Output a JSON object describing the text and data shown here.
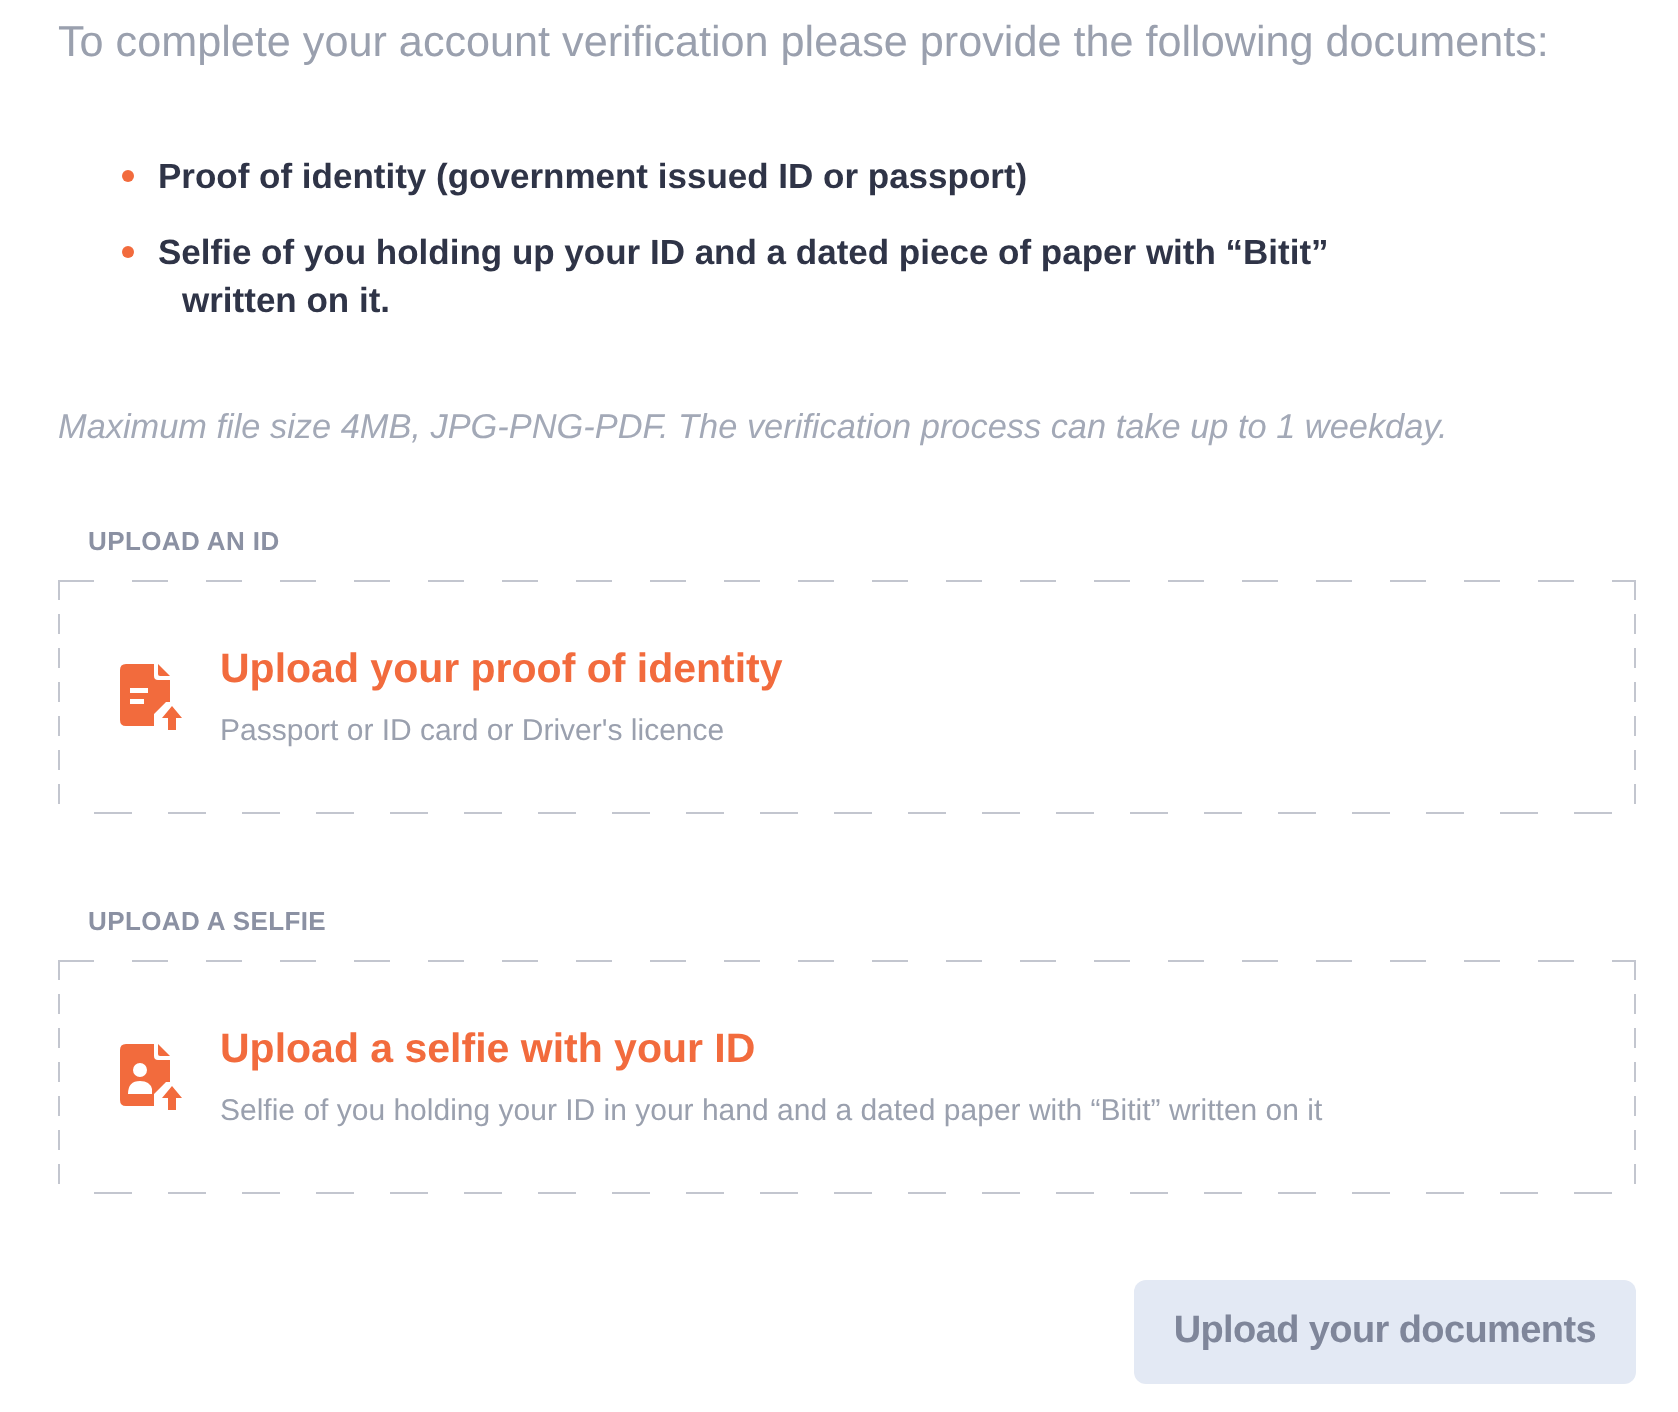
{
  "intro": "To complete your account verification please provide the following documents:",
  "requirements": [
    "Proof of identity (government issued ID or passport)",
    "Selfie of you holding up your ID and a dated piece of paper with “Bitit” written on it."
  ],
  "note": "Maximum file size 4MB, JPG-PNG-PDF. The verification process can take up to 1 weekday.",
  "uploads": [
    {
      "kind": "document",
      "label": "UPLOAD AN ID",
      "title": "Upload your proof of identity",
      "hint": "Passport or ID card or Driver's licence"
    },
    {
      "kind": "selfie",
      "label": "UPLOAD A SELFIE",
      "title": "Upload a selfie with your ID",
      "hint": "Selfie of you holding your ID in your hand and a dated paper with “Bitit” written on it"
    }
  ],
  "submit_button": {
    "label": "Upload your documents",
    "disabled": true
  }
}
